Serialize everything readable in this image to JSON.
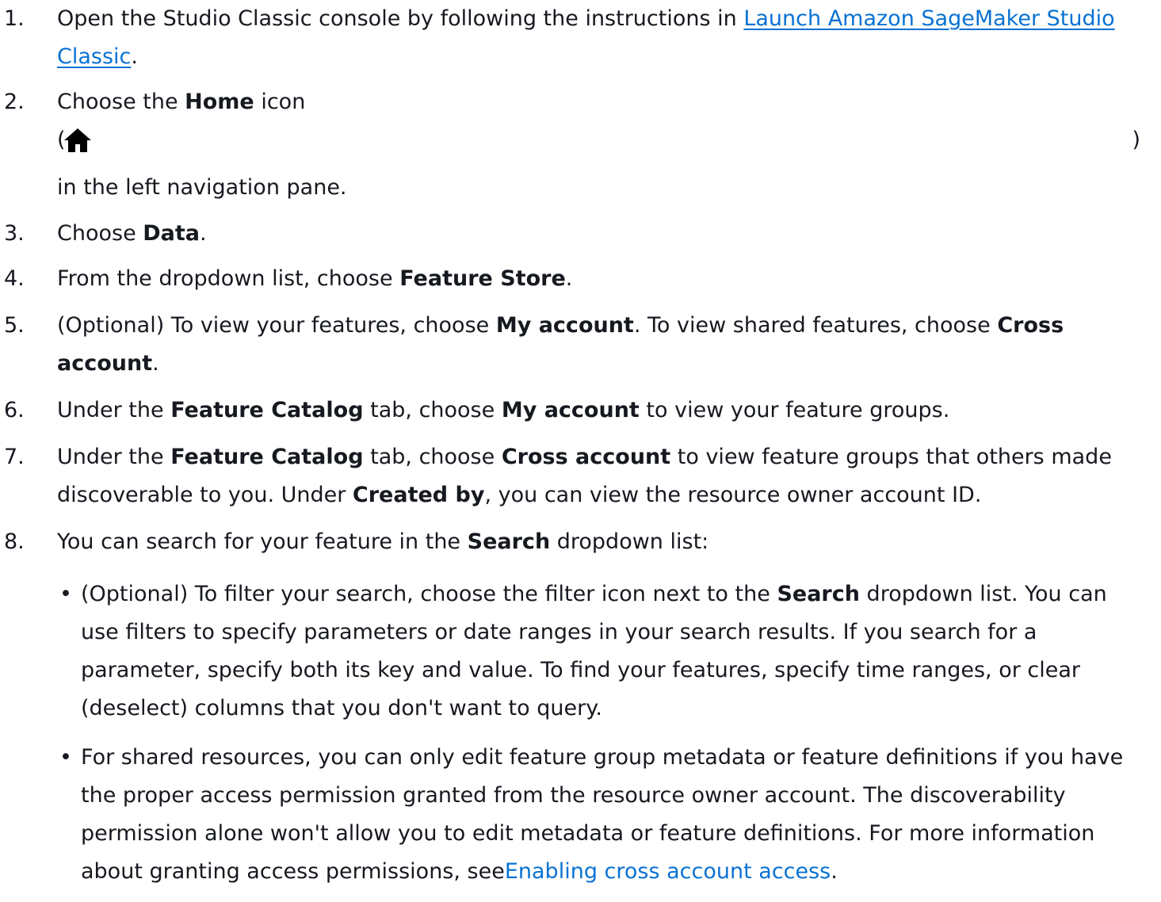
{
  "steps": [
    {
      "num": "1.",
      "pre": "Open the Studio Classic console by following the instructions in ",
      "link": "Launch Amazon SageMaker Studio Classic",
      "post": "."
    },
    {
      "num": "2.",
      "pre": "Choose the ",
      "bold": "Home",
      "post": " icon",
      "paren_open": "(",
      "icon": "home-icon",
      "paren_close": ")",
      "line3": "in the left navigation pane."
    },
    {
      "num": "3.",
      "pre": "Choose ",
      "bold": "Data",
      "post": "."
    },
    {
      "num": "4.",
      "pre": "From the dropdown list, choose ",
      "bold": "Feature Store",
      "post": "."
    },
    {
      "num": "5.",
      "pre": "(Optional) To view your features, choose ",
      "bold1": "My account",
      "mid": ". To view shared features, choose ",
      "bold2": "Cross account",
      "post": "."
    },
    {
      "num": "6.",
      "pre": "Under the ",
      "bold1": "Feature Catalog",
      "mid": " tab, choose ",
      "bold2": "My account",
      "post": " to view your feature groups."
    },
    {
      "num": "7.",
      "pre": "Under the ",
      "bold1": "Feature Catalog",
      "mid1": " tab, choose ",
      "bold2": "Cross account",
      "mid2": " to view feature groups that others made discoverable to you. Under ",
      "bold3": "Created by",
      "post": ", you can view the resource owner account ID."
    },
    {
      "num": "8.",
      "pre": "You can search for your feature in the ",
      "bold": "Search",
      "post": " dropdown list:",
      "bullets": [
        {
          "dot": "•",
          "pre": "(Optional) To filter your search, choose the filter icon next to the ",
          "bold": "Search",
          "post": " dropdown list. You can use filters to specify parameters or date ranges in your search results. If you search for a parameter, specify both its key and value. To find your features, specify time ranges, or clear (deselect) columns that you don't want to query."
        },
        {
          "dot": "•",
          "pre": "For shared resources, you can only edit feature group metadata or feature definitions if you have the proper access permission granted from the resource owner account. The discoverability permission alone won't allow you to edit metadata or feature definitions. For more information about granting access permissions, see",
          "link": "Enabling cross account access",
          "post": "."
        }
      ]
    }
  ]
}
